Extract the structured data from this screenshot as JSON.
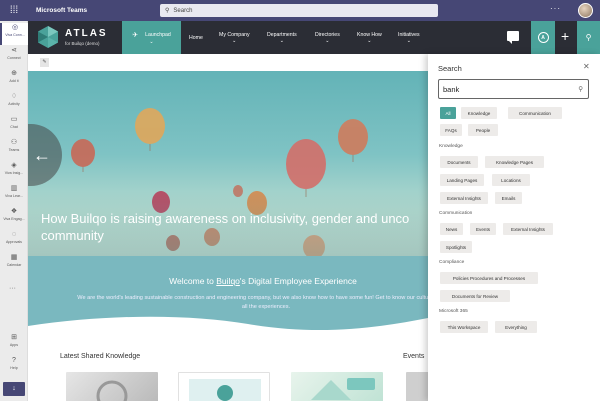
{
  "teams": {
    "app_title": "Microsoft Teams",
    "search_placeholder": "Search",
    "more_glyph": "···"
  },
  "rail": {
    "items": [
      {
        "label": "Viva Conn...",
        "icon": "viva-connections-icon",
        "glyph": "◎"
      },
      {
        "label": "Connect",
        "icon": "share-icon",
        "glyph": "⋖"
      },
      {
        "label": "Add it",
        "icon": "add-icon",
        "glyph": "⊕"
      },
      {
        "label": "Activity",
        "icon": "bell-icon",
        "glyph": "♢"
      },
      {
        "label": "Chat",
        "icon": "chat-icon",
        "glyph": "▭"
      },
      {
        "label": "Teams",
        "icon": "teams-icon",
        "glyph": "⚇"
      },
      {
        "label": "Viva Insig...",
        "icon": "insights-icon",
        "glyph": "◈"
      },
      {
        "label": "Viva Lear...",
        "icon": "learning-icon",
        "glyph": "▥"
      },
      {
        "label": "Viva Engag...",
        "icon": "engage-icon",
        "glyph": "❖"
      },
      {
        "label": "Approvals",
        "icon": "approvals-icon",
        "glyph": "◌"
      },
      {
        "label": "Calendar",
        "icon": "calendar-icon",
        "glyph": "▦"
      },
      {
        "label": "Apps",
        "icon": "apps-icon",
        "glyph": "⊞"
      },
      {
        "label": "Help",
        "icon": "help-icon",
        "glyph": "?"
      }
    ],
    "more_glyph": "···",
    "download_glyph": "↓"
  },
  "nav": {
    "logo_title": "ATLAS",
    "logo_subtitle": "for Builqo (demo)",
    "launchpad": "Launchpad",
    "items": [
      "Home",
      "My Company",
      "Departments",
      "Directories",
      "Know How",
      "Initiatives"
    ],
    "atlas_btn": "A"
  },
  "hero": {
    "title_line1": "How Builqo is raising awareness on inclusivity, gender and unco",
    "title_line2": "community"
  },
  "welcome": {
    "title_pre": "Welcome to ",
    "title_link": "Builqo",
    "title_post": "'s Digital Employee Experience",
    "body": "We are the world's leading sustainable construction and engineering company, but we also know how to have some fun! Get to know our culture and find all the experiences."
  },
  "sections": {
    "shared_knowledge": "Latest Shared Knowledge",
    "events": "Events"
  },
  "search_panel": {
    "title": "Search",
    "query": "bank",
    "filters": [
      "All",
      "Knowledge",
      "Communication",
      "FAQs",
      "People"
    ],
    "groups": [
      {
        "name": "Knowledge",
        "items": [
          "Documents",
          "Knowledge Pages",
          "Landing Pages",
          "Locations",
          "External Insights",
          "Emails"
        ]
      },
      {
        "name": "Communication",
        "items": [
          "News",
          "Events",
          "External Insights",
          "Spotlights"
        ]
      },
      {
        "name": "Compliance",
        "items": [
          "Policies Procedures and Processes",
          "Documents for Review"
        ]
      },
      {
        "name": "Microsoft 365",
        "items": [
          "This Workspace",
          "Everything"
        ]
      }
    ]
  },
  "colors": {
    "teams_purple": "#464775",
    "atlas_teal": "#4aa29a",
    "nav_dark": "#2b2d35"
  }
}
